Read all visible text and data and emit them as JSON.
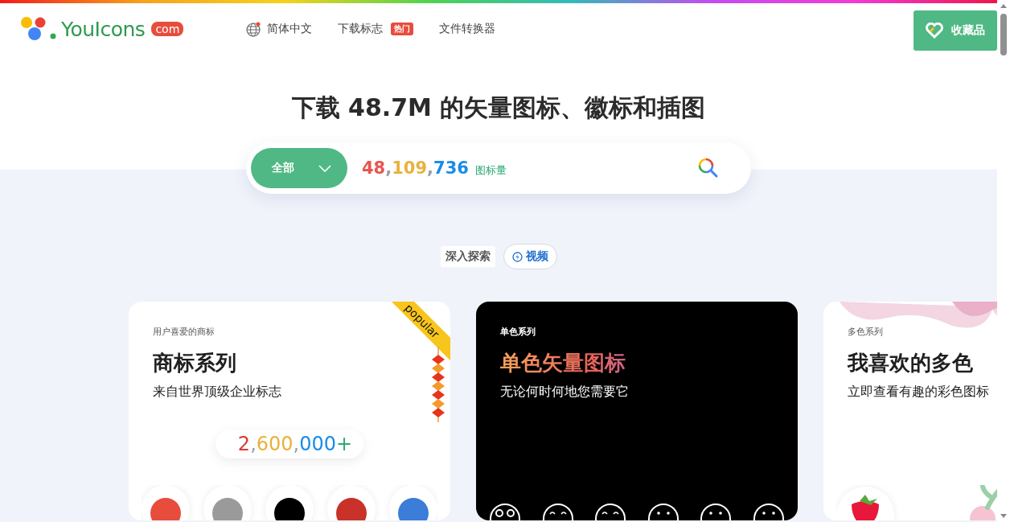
{
  "header": {
    "logo": {
      "name": "YouIcons",
      "suffix": "com"
    },
    "nav": [
      {
        "label": "简体中文",
        "kind": "language"
      },
      {
        "label": "下载标志",
        "kind": "badge",
        "badge": "热门"
      },
      {
        "label": "文件转换器",
        "kind": "plain"
      }
    ],
    "favorites_button": "收藏品"
  },
  "hero": {
    "title": "下载 48.7M 的矢量图标、徽标和插图",
    "search": {
      "category": "全部",
      "count_parts": [
        {
          "text": "48",
          "color": "#e8554e"
        },
        {
          "text": ",",
          "color": "#9aa0a6"
        },
        {
          "text": "109",
          "color": "#e9b13c"
        },
        {
          "text": ",",
          "color": "#9aa0a6"
        },
        {
          "text": "736",
          "color": "#1a8ce8"
        }
      ],
      "count_label": "图标量"
    }
  },
  "explore": {
    "label": "深入探索",
    "video_link": "视频"
  },
  "cards": [
    {
      "kind": "brand",
      "eyebrow": "用户喜爱的商标",
      "title": "商标系列",
      "subtitle": "来自世界顶级企业标志",
      "ribbon": "popular",
      "counter_parts": [
        {
          "text": "2",
          "color": "#d93a3a"
        },
        {
          "text": ",",
          "color": "#9aa0a6"
        },
        {
          "text": "600",
          "color": "#e9b13c"
        },
        {
          "text": ",",
          "color": "#9aa0a6"
        },
        {
          "text": "000",
          "color": "#1a8ce8"
        },
        {
          "text": "+",
          "color": "#2aa872"
        }
      ]
    },
    {
      "kind": "mono",
      "eyebrow": "单色系列",
      "title": "单色矢量图标",
      "subtitle": "无论何时何地您需要它"
    },
    {
      "kind": "multicolor",
      "eyebrow": "多色系列",
      "title": "我喜欢的多色",
      "subtitle": "立即查看有趣的彩色图标"
    }
  ]
}
